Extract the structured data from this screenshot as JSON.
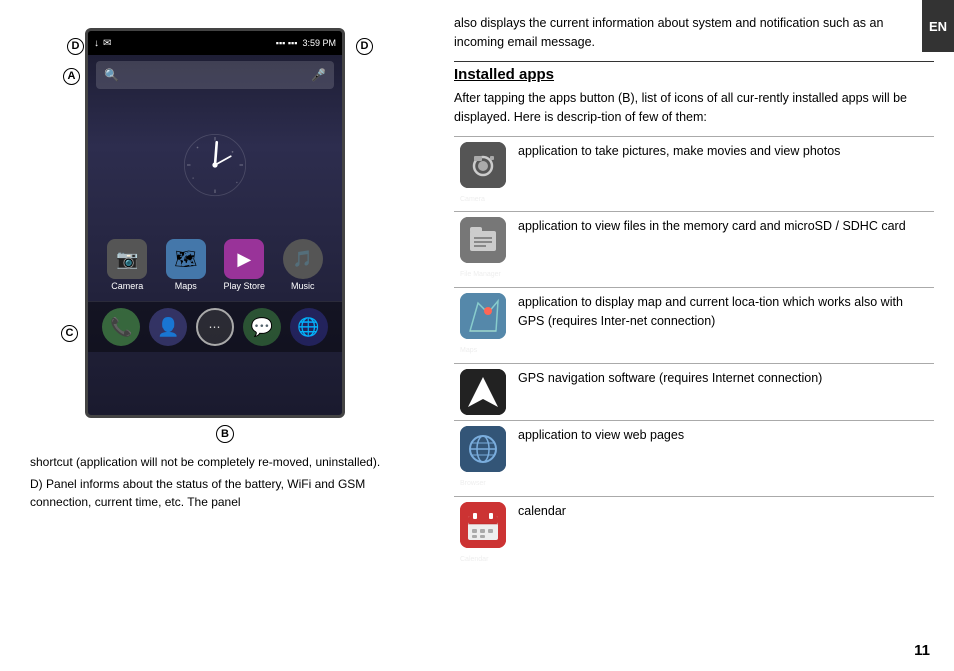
{
  "left": {
    "labels": {
      "d": "D",
      "a": "A",
      "c": "C",
      "b": "B"
    },
    "status_bar": {
      "time": "3:59 PM",
      "icons": [
        "↓",
        "✉"
      ]
    },
    "search_placeholder": "Search",
    "apps": [
      {
        "label": "Camera",
        "icon": "📷"
      },
      {
        "label": "Maps",
        "icon": "🗺"
      },
      {
        "label": "Play Store",
        "icon": "▶"
      },
      {
        "label": "Music",
        "icon": "🎵"
      }
    ],
    "dock_icons": [
      "📞",
      "👤",
      "⋯",
      "💬",
      "🌐"
    ],
    "bottom_texts": {
      "line1": "shortcut (application will not be completely re-moved, uninstalled).",
      "line2_prefix": "D)",
      "line2": "Panel informs about the status of the battery, WiFi and GSM connection, current time, etc. The panel"
    }
  },
  "right": {
    "intro": "also displays the current information about system and notification such as an incoming email message.",
    "section_title": "Installed apps",
    "section_desc": "After tapping the apps button (B), list of icons of all cur-rently installed apps will be displayed. Here is descrip-tion of few of them:",
    "apps": [
      {
        "name": "Camera",
        "icon_label": "Camera",
        "icon_bg": "#555555",
        "description": "application to take pictures, make movies and view photos"
      },
      {
        "name": "File Manager",
        "icon_label": "File Manager",
        "icon_bg": "#888888",
        "description": "application to view files in the memory card and microSD / SDHC card"
      },
      {
        "name": "Maps",
        "icon_label": "Maps",
        "icon_bg": "#6699aa",
        "description": "application to display map and current loca-tion which works also with GPS (requires Inter-net connection)"
      },
      {
        "name": "Navigation",
        "icon_label": "",
        "icon_bg": "#222222",
        "description": "GPS navigation software (requires Internet connection)"
      },
      {
        "name": "Browser",
        "icon_label": "Browser",
        "icon_bg": "#335577",
        "description": "application to view web pages"
      },
      {
        "name": "Calendar",
        "icon_label": "Calendar",
        "icon_bg": "#dd4444",
        "description": "calendar"
      }
    ],
    "page_number": "11",
    "en_label": "EN"
  }
}
